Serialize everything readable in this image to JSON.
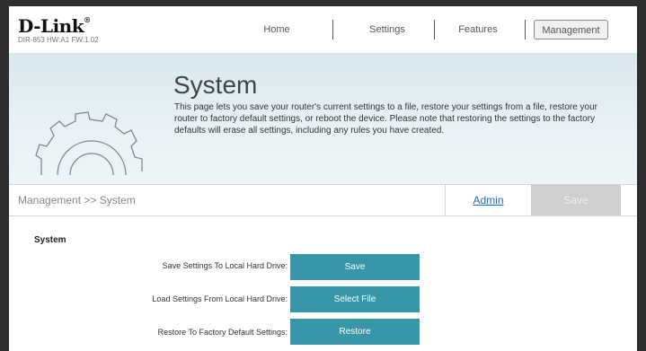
{
  "header": {
    "brand": "D-Link",
    "brand_mark": "®",
    "model": "DIR-853 HW:A1 FW:1.02",
    "nav": [
      {
        "label": "Home"
      },
      {
        "label": "Settings"
      },
      {
        "label": "Features"
      },
      {
        "label": "Management"
      }
    ]
  },
  "banner": {
    "title": "System",
    "icon": "gear-icon",
    "description": "This page lets you save your router's current settings to a file, restore your settings from a file, restore your router to factory default settings, or reboot the device. Please note that restoring the settings to the factory defaults will erase all settings, including any rules you have created."
  },
  "breadcrumb": {
    "path": "Management >> System",
    "admin_link": "Admin",
    "save_label": "Save"
  },
  "section": {
    "title": "System",
    "rows": [
      {
        "label": "Save Settings To Local Hard Drive:",
        "button": "Save"
      },
      {
        "label": "Load Settings From Local Hard Drive:",
        "button": "Select File"
      },
      {
        "label": "Restore To Factory Default Settings:",
        "button": "Restore"
      }
    ]
  },
  "colors": {
    "accent_button": "#3796a7",
    "banner_bg": "#e4eff4",
    "link": "#1a6fb4"
  }
}
